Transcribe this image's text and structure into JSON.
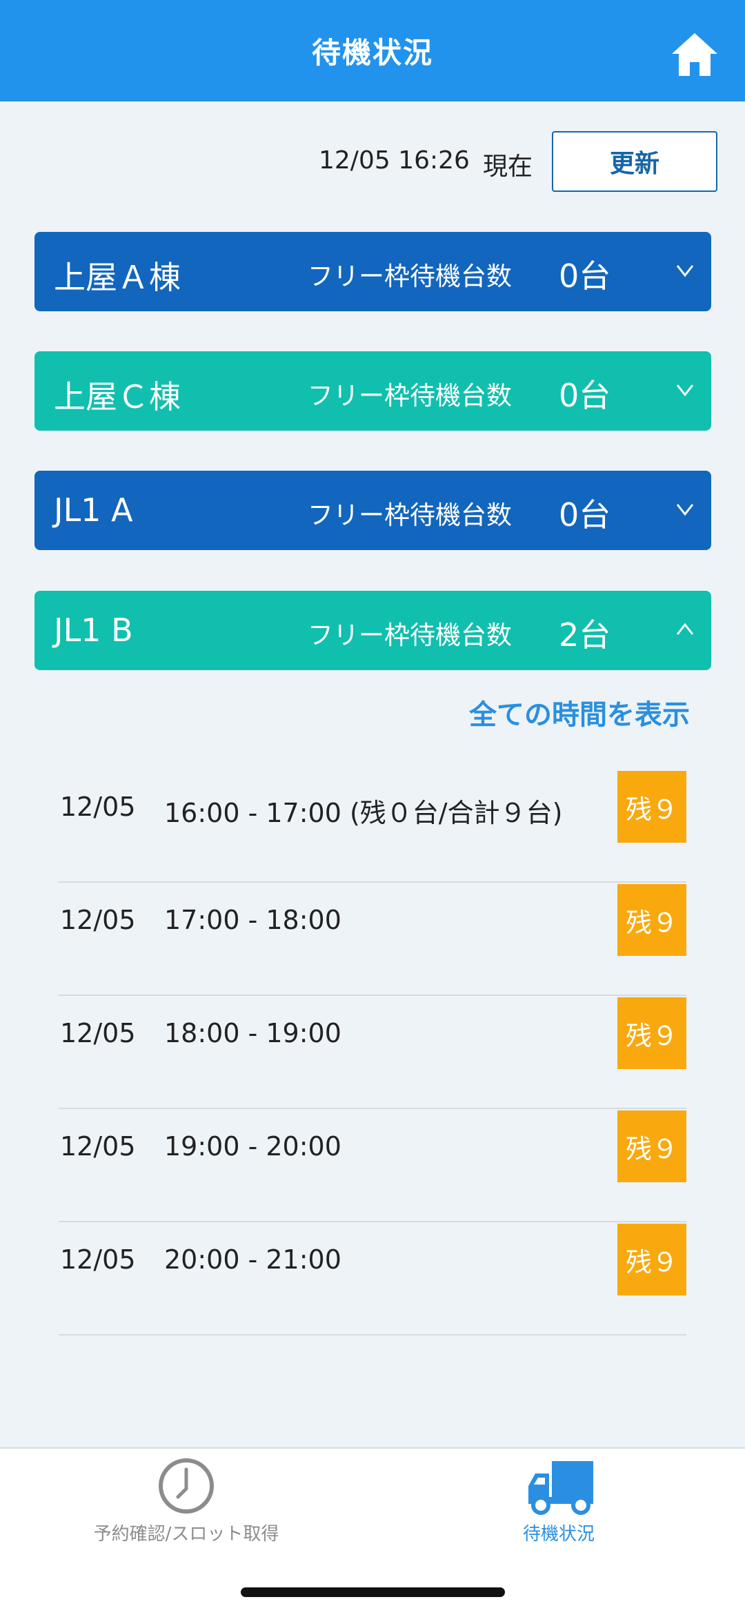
{
  "header": {
    "title": "待機状況"
  },
  "status": {
    "timestamp": "12/05 16:26",
    "now_label": "現在",
    "refresh_label": "更新"
  },
  "buildings": [
    {
      "name": "上屋Ａ棟",
      "label": "フリー枠待機台数",
      "count": "0台",
      "expanded": false,
      "color": "#1266bd"
    },
    {
      "name": "上屋Ｃ棟",
      "label": "フリー枠待機台数",
      "count": "0台",
      "expanded": false,
      "color": "#10bfae"
    },
    {
      "name": "JL1 A",
      "label": "フリー枠待機台数",
      "count": "0台",
      "expanded": false,
      "color": "#1266bd"
    },
    {
      "name": "JL1 B",
      "label": "フリー枠待機台数",
      "count": "2台",
      "expanded": true,
      "color": "#10bfae"
    }
  ],
  "show_all_label": "全ての時間を表示",
  "slots": [
    {
      "date": "12/05",
      "time": "16:00 - 17:00  (残０台/合計９台)",
      "badge": "残９"
    },
    {
      "date": "12/05",
      "time": "17:00 - 18:00",
      "badge": "残９"
    },
    {
      "date": "12/05",
      "time": "18:00 - 19:00",
      "badge": "残９"
    },
    {
      "date": "12/05",
      "time": "19:00 - 20:00",
      "badge": "残９"
    },
    {
      "date": "12/05",
      "time": "20:00 - 21:00",
      "badge": "残９"
    }
  ],
  "tabs": {
    "left_label": "予約確認/スロット取得",
    "right_label": "待機状況",
    "active": "right"
  },
  "colors": {
    "header": "#2293ec",
    "badge": "#f9a90e",
    "accent": "#2a8fe0"
  }
}
